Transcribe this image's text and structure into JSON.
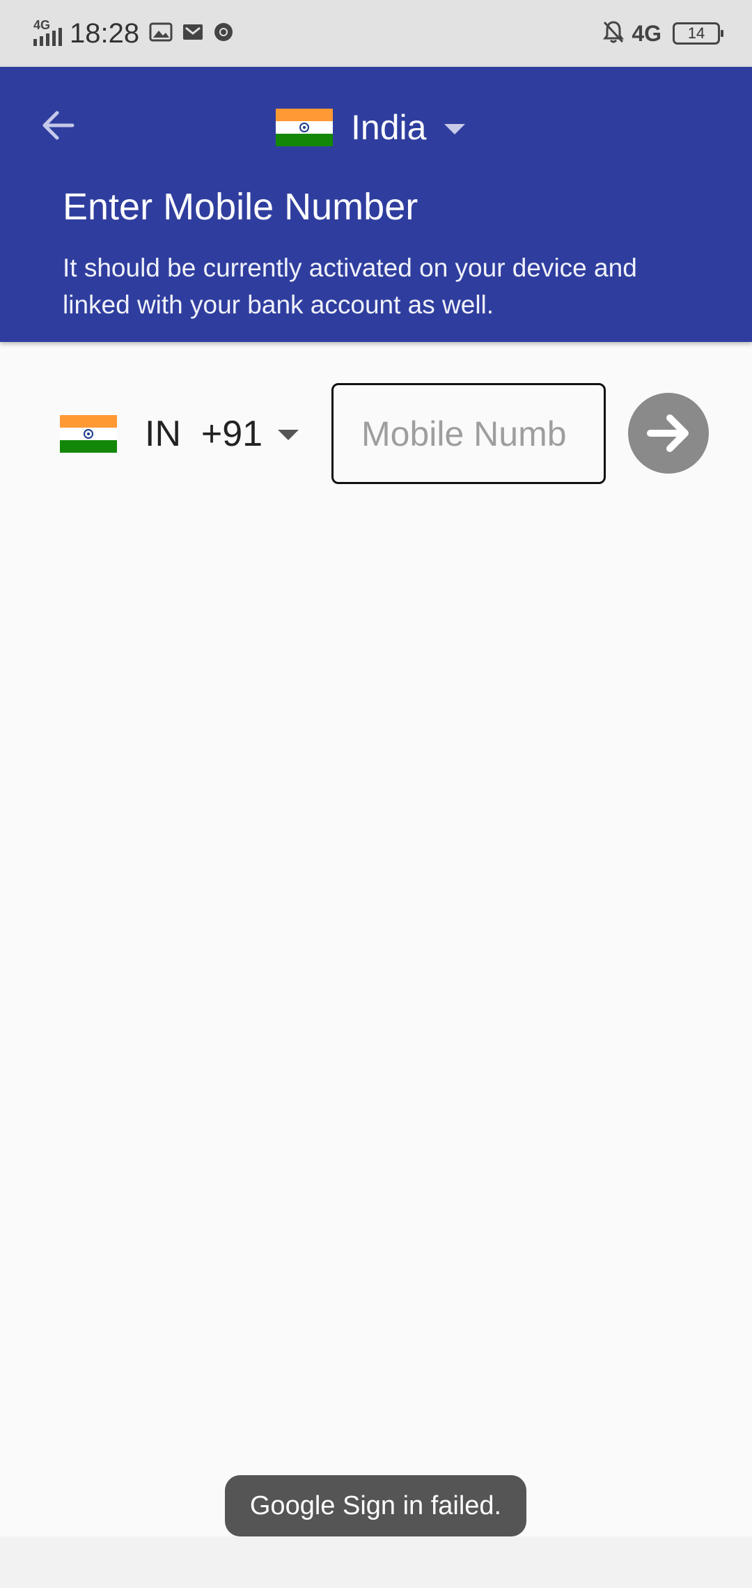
{
  "status_bar": {
    "network_left": "4G",
    "time": "18:28",
    "network_right": "4G",
    "battery": "14",
    "icons": [
      "signal-icon",
      "gallery-icon",
      "gmail-icon",
      "chrome-icon",
      "mute-bell-icon",
      "battery-icon"
    ]
  },
  "header": {
    "back_icon": "back-arrow-icon",
    "country": "India",
    "title": "Enter Mobile Number",
    "subtitle": "It should be currently activated on your device and linked with your bank account as well."
  },
  "phone": {
    "country_code": "IN  +91",
    "placeholder": "Mobile Numb",
    "value": "",
    "submit_icon": "arrow-right-icon"
  },
  "toast": {
    "message": "Google Sign in failed."
  },
  "colors": {
    "header_bg": "#2f3e9e",
    "page_bg": "#fafafa",
    "status_bg": "#e2e2e2",
    "submit_bg": "#8a8a8a",
    "toast_bg": "#555555",
    "flag_saffron": "#ff9933",
    "flag_green": "#138808"
  }
}
